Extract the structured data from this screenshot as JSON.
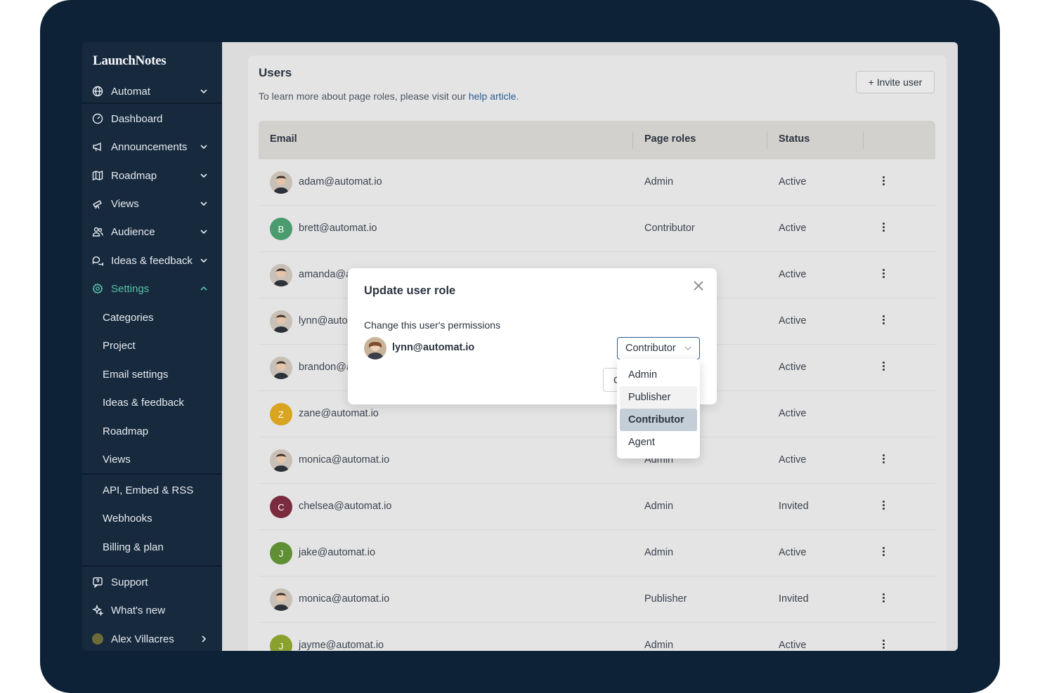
{
  "sidebar": {
    "logo": "LaunchNotes",
    "workspace": "Automat",
    "nav": [
      {
        "label": "Dashboard"
      },
      {
        "label": "Announcements"
      },
      {
        "label": "Roadmap"
      },
      {
        "label": "Views"
      },
      {
        "label": "Audience"
      },
      {
        "label": "Ideas & feedback"
      },
      {
        "label": "Settings"
      }
    ],
    "settings_items": [
      "Categories",
      "Project",
      "Email settings",
      "Ideas & feedback",
      "Roadmap",
      "Views"
    ],
    "admin_items": [
      "API, Embed & RSS",
      "Webhooks",
      "Billing & plan"
    ],
    "support": "Support",
    "whats_new": "What's new",
    "user": "Alex Villacres",
    "accent_color": "#5ac0a8"
  },
  "main": {
    "title": "Users",
    "subtitle_prefix": "To learn more about page roles, please visit our ",
    "subtitle_link": "help article.",
    "invite_button": "+ Invite user",
    "columns": [
      "Email",
      "Page roles",
      "Status"
    ],
    "rows": [
      {
        "email": "adam@automat.io",
        "role": "Admin",
        "status": "Active",
        "avatar": "photo"
      },
      {
        "email": "brett@automat.io",
        "role": "Contributor",
        "status": "Active",
        "avatar": "B",
        "color": "#4a9b6e"
      },
      {
        "email": "amanda@automat.io",
        "role": "",
        "status": "Active",
        "avatar": "photo"
      },
      {
        "email": "lynn@automat.io",
        "role": "",
        "status": "Active",
        "avatar": "photo"
      },
      {
        "email": "brandon@automat.io",
        "role": "",
        "status": "Active",
        "avatar": "photo"
      },
      {
        "email": "zane@automat.io",
        "role": "",
        "status": "Active",
        "avatar": "Z",
        "color": "#d9a420"
      },
      {
        "email": "monica@automat.io",
        "role": "Admin",
        "status": "Active",
        "avatar": "photo"
      },
      {
        "email": "chelsea@automat.io",
        "role": "Admin",
        "status": "Invited",
        "avatar": "C",
        "color": "#7a2c3e"
      },
      {
        "email": "jake@automat.io",
        "role": "Admin",
        "status": "Active",
        "avatar": "J",
        "color": "#5e8f34"
      },
      {
        "email": "monica@automat.io",
        "role": "Publisher",
        "status": "Invited",
        "avatar": "photo"
      },
      {
        "email": "jayme@automat.io",
        "role": "Admin",
        "status": "Active",
        "avatar": "J",
        "color": "#8aa12e"
      }
    ]
  },
  "modal": {
    "title": "Update user role",
    "label": "Change this user's permissions",
    "user_email": "lynn@automat.io",
    "selected_role": "Contributor",
    "cancel_partial": "C",
    "options": [
      "Admin",
      "Publisher",
      "Contributor",
      "Agent"
    ]
  }
}
